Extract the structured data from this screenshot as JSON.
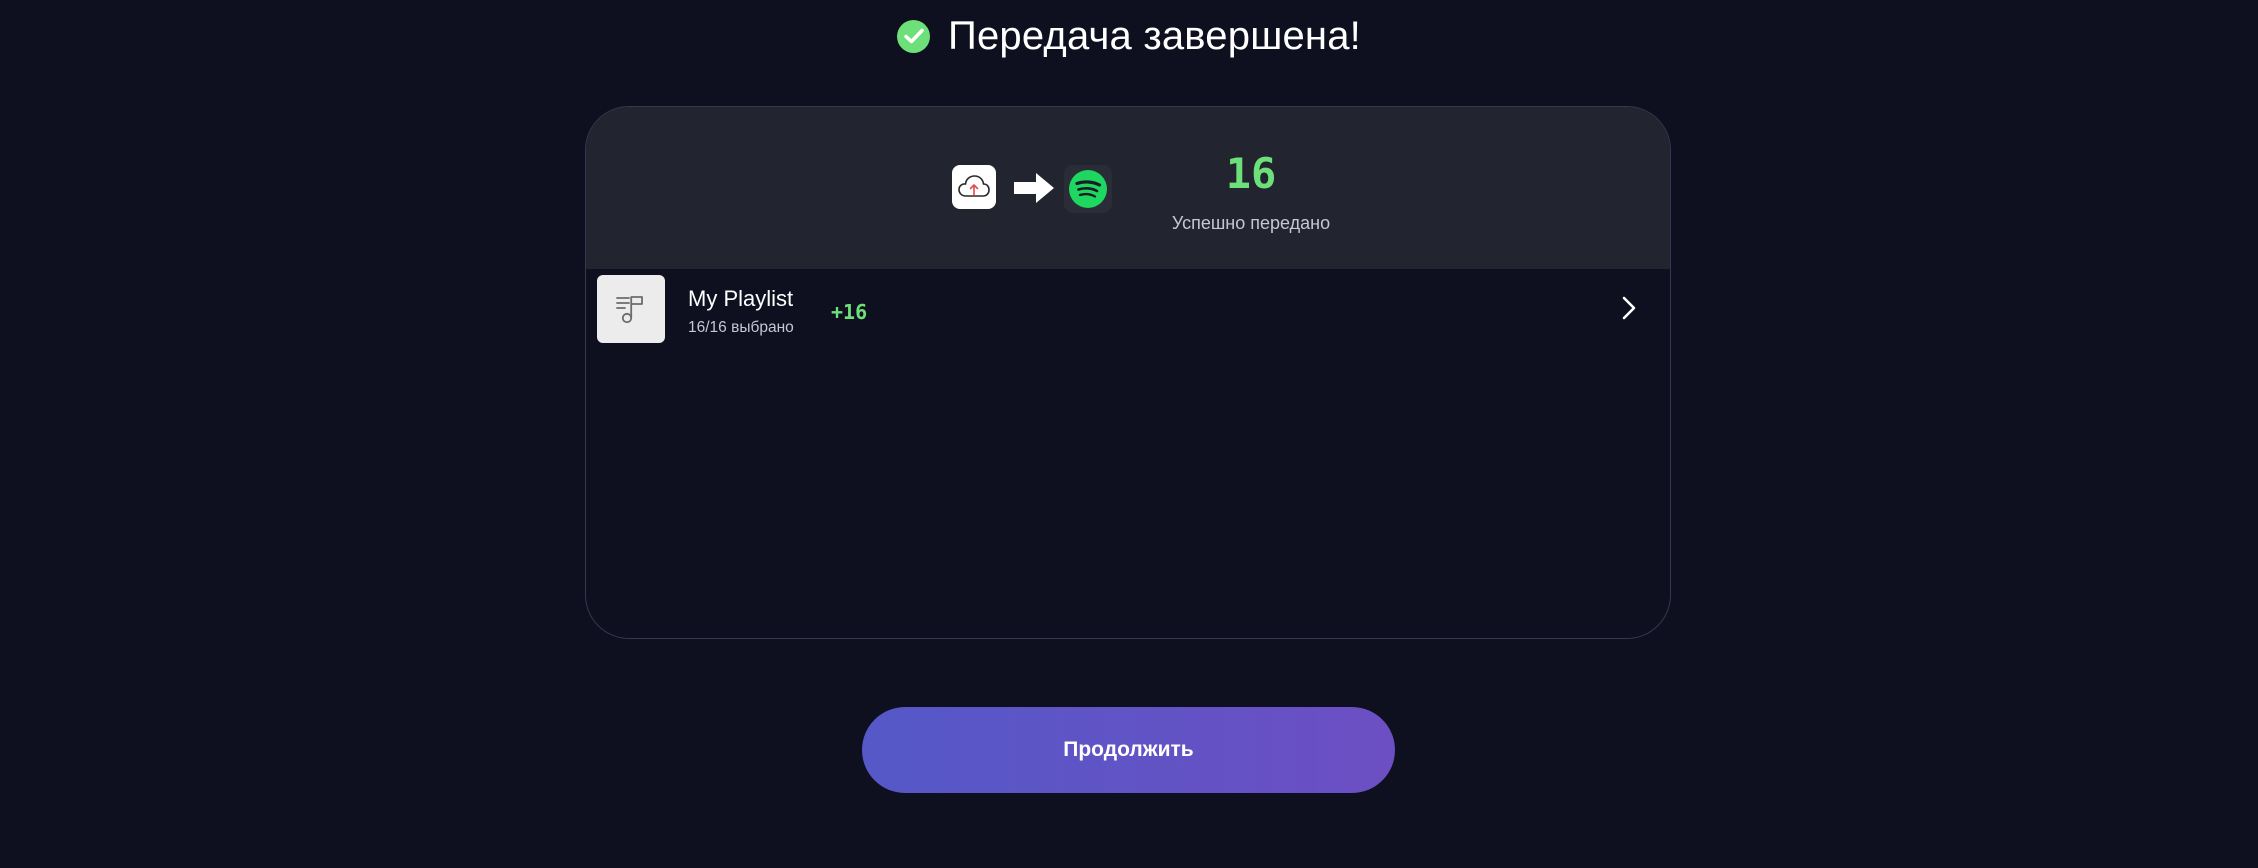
{
  "header": {
    "title": "Передача завершена!",
    "status_icon": "check-circle-icon"
  },
  "summary": {
    "source_service_icon": "cloud-upload-icon",
    "transfer_icon": "arrow-right-icon",
    "target_service_icon": "spotify-icon",
    "count": "16",
    "count_label": "Успешно передано"
  },
  "playlists": [
    {
      "name": "My Playlist",
      "subtitle": "16/16 выбрано",
      "delta": "+16",
      "thumb_icon": "music-playlist-icon"
    }
  ],
  "actions": {
    "continue_label": "Продолжить"
  },
  "colors": {
    "background": "#0e1020",
    "card_header": "#22252f",
    "accent_green": "#6ee07a",
    "button_gradient_start": "#5558c8",
    "button_gradient_end": "#6c4fc3",
    "spotify_green": "#1ed760"
  }
}
